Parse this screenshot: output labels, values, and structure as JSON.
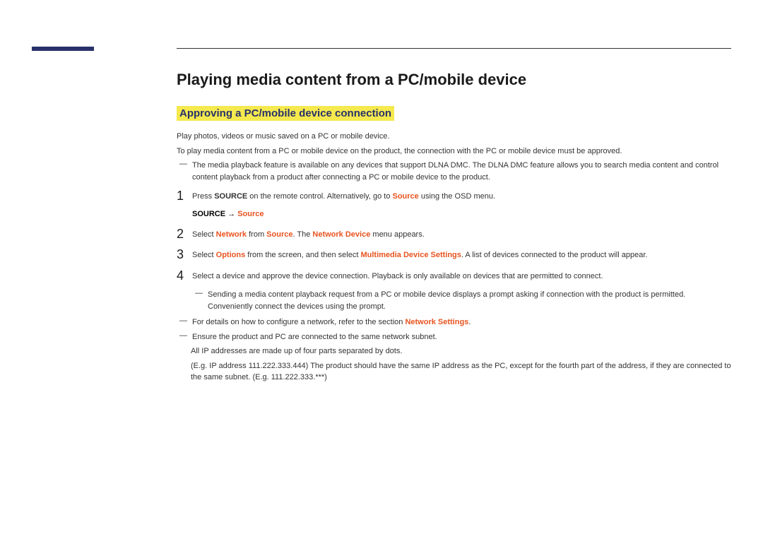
{
  "title": "Playing media content from a PC/mobile device",
  "subtitle": "Approving a PC/mobile device connection",
  "intro1": "Play photos, videos or music saved on a PC or mobile device.",
  "intro2": "To play media content from a PC or mobile device on the product, the connection with the PC or mobile device must be approved.",
  "note_dlna": "The media playback feature is available on any devices that support DLNA DMC. The DLNA DMC feature allows you to search media content and control content playback from a product after connecting a PC or mobile device to the product.",
  "steps": {
    "s1": {
      "num": "1",
      "pre": "Press ",
      "bold1": "SOURCE",
      "mid": " on the remote control. Alternatively, go to ",
      "orange1": "Source",
      "post": " using the OSD menu."
    },
    "source_line": {
      "bold": "SOURCE",
      "arrow": " → ",
      "orange": "Source"
    },
    "s2": {
      "num": "2",
      "pre": "Select ",
      "orange1": "Network",
      "mid1": " from ",
      "orange2": "Source",
      "mid2": ". The ",
      "orange3": "Network Device",
      "post": " menu appears."
    },
    "s3": {
      "num": "3",
      "pre": "Select ",
      "orange1": "Options",
      "mid": " from the screen, and then select ",
      "orange2": "Multimedia Device Settings",
      "post": ". A list of devices connected to the product will appear."
    },
    "s4": {
      "num": "4",
      "text": "Select a device and approve the device connection. Playback is only available on devices that are permitted to connect."
    }
  },
  "note_prompt": "Sending a media content playback request from a PC or mobile device displays a prompt asking if connection with the product is permitted. Conveniently connect the devices using the prompt.",
  "note_network": {
    "pre": "For details on how to configure a network, refer to the section ",
    "orange": "Network Settings",
    "post": "."
  },
  "note_subnet": "Ensure the product and PC are connected to the same network subnet.",
  "sub_ip1": "All IP addresses are made up of four parts separated by dots.",
  "sub_ip2": "(E.g. IP address 111.222.333.444) The product should have the same IP address as the PC, except for the fourth part of the address, if they are connected to the same subnet. (E.g. 111.222.333.***)"
}
